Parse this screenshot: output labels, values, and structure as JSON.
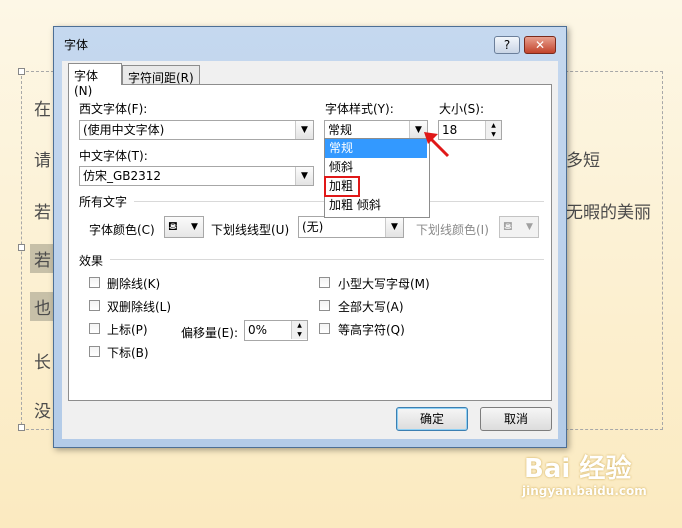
{
  "slide_text": {
    "line1": "在",
    "line2": "请",
    "line2_right": "多短",
    "line3": "若",
    "line3_right": "无暇的美丽",
    "line4": "若",
    "line5": "也",
    "line6": "长",
    "line7": "没"
  },
  "dialog": {
    "title": "字体",
    "help_button": "?",
    "close_button": "✕",
    "tabs": [
      "字体(N)",
      "字符间距(R)"
    ],
    "western_font_label": "西文字体(F):",
    "western_font_value": "(使用中文字体)",
    "style_label": "字体样式(Y):",
    "style_value": "常规",
    "size_label": "大小(S):",
    "size_value": "18",
    "chinese_font_label": "中文字体(T):",
    "chinese_font_value": "仿宋_GB2312",
    "style_options": [
      "常规",
      "倾斜",
      "加粗",
      "加粗 倾斜"
    ],
    "all_text_section": "所有文字",
    "font_color_label": "字体颜色(C)",
    "underline_style_label": "下划线线型(U)",
    "underline_style_value": "(无)",
    "underline_color_label": "下划线颜色(I)",
    "effects_section": "效果",
    "effects_left": [
      "删除线(K)",
      "双删除线(L)",
      "上标(P)",
      "下标(B)"
    ],
    "effects_right": [
      "小型大写字母(M)",
      "全部大写(A)",
      "等高字符(Q)"
    ],
    "offset_label": "偏移量(E):",
    "offset_value": "0%",
    "ok_button": "确定",
    "cancel_button": "取消"
  },
  "watermark": {
    "brand": "Bai 经验",
    "url": "jingyan.baidu.com"
  },
  "colors": {
    "highlight_option": "#3399ff",
    "annotation_red": "#e01818"
  }
}
